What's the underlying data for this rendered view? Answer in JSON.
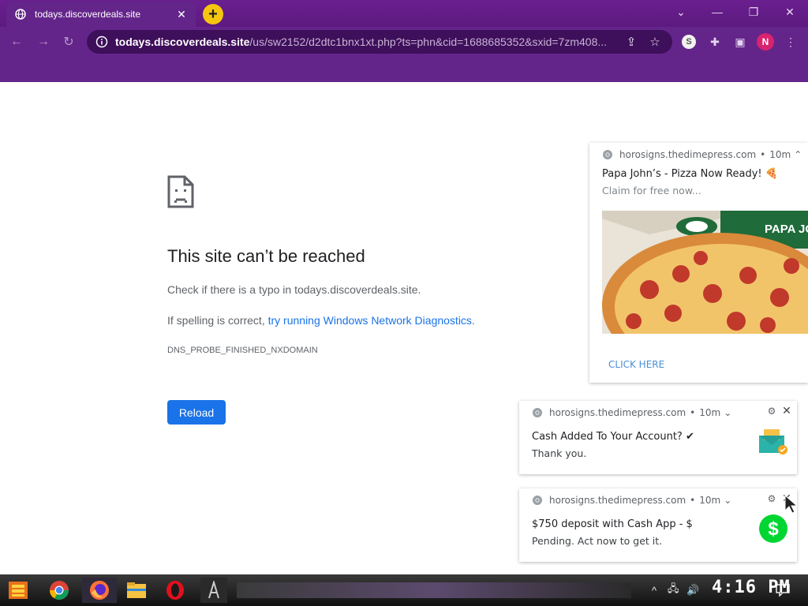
{
  "browser": {
    "tab_title": "todays.discoverdeals.site",
    "url_host": "todays.discoverdeals.site",
    "url_path": "/us/sw2152/d2dtc1bnx1xt.php?ts=phn&cid=1688685352&sxid=7zm408...",
    "profile_initial": "N",
    "shield_letter": "S",
    "icons": [
      "globe-icon",
      "close-icon",
      "new-tab-icon",
      "chevron-down-icon",
      "minimize-icon",
      "restore-icon",
      "back-icon",
      "forward-icon",
      "refresh-icon",
      "info-icon",
      "share-icon",
      "star-icon",
      "extensions-icon",
      "side-panel-icon",
      "kebab-menu-icon"
    ]
  },
  "error_page": {
    "title": "This site can’t be reached",
    "line1": "Check if there is a typo in todays.discoverdeals.site.",
    "line2_prefix": "If spelling is correct, ",
    "line2_link": "try running Windows Network Diagnostics",
    "line2_suffix": ".",
    "error_code": "DNS_PROBE_FINISHED_NXDOMAIN",
    "reload_label": "Reload"
  },
  "notifications": [
    {
      "source": "horosigns.thedimepress.com",
      "age": "10m",
      "title": "Papa John’s - Pizza Now Ready! 🍕",
      "body": "Claim for free now...",
      "image_text": "PAPA JO",
      "action": "CLICK HERE"
    },
    {
      "source": "horosigns.thedimepress.com",
      "age": "10m",
      "title": "Cash Added To Your Account? ✔",
      "body": "Thank you."
    },
    {
      "source": "horosigns.thedimepress.com",
      "age": "10m",
      "title": "$750 deposit with Cash App - $",
      "body": "Pending. Act now to get it."
    }
  ],
  "taskbar": {
    "clock": "4:16 PM",
    "apps": [
      "start-button",
      "chrome-icon",
      "firefox-icon",
      "file-explorer-icon",
      "opera-icon",
      "app-icon"
    ],
    "tray": [
      "chevron-up-icon",
      "network-icon",
      "volume-icon",
      "notification-center-icon"
    ]
  },
  "colors": {
    "chrome_purple": "#64258a",
    "omnibox": "#3e0f5a",
    "link_blue": "#1a73e8",
    "new_tab_yellow": "#f6c510",
    "cash_app_green": "#00d632"
  }
}
